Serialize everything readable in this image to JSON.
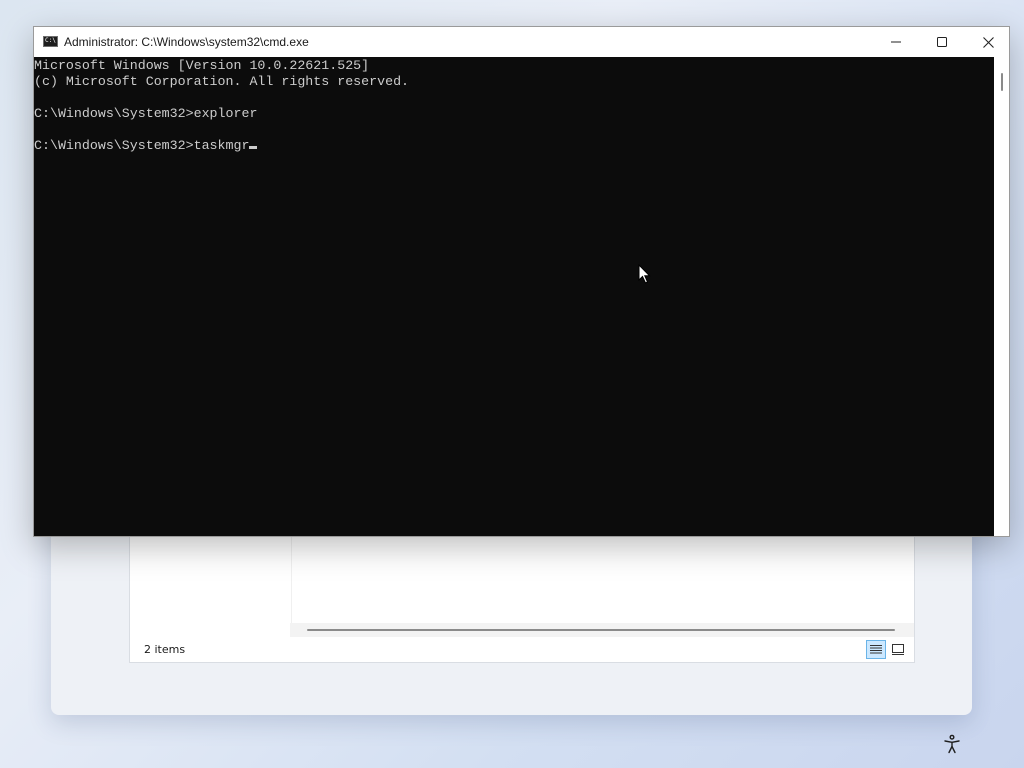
{
  "cmd": {
    "window_title": "Administrator: C:\\Windows\\system32\\cmd.exe",
    "icon": "cmd-icon",
    "icon_text": "C:\\",
    "lines": [
      "Microsoft Windows [Version 10.0.22621.525]",
      "(c) Microsoft Corporation. All rights reserved.",
      "",
      "C:\\Windows\\System32>explorer",
      "",
      "C:\\Windows\\System32>taskmgr"
    ],
    "background": "#0c0c0c",
    "foreground": "#cccccc"
  },
  "explorer": {
    "status_text": "2 items",
    "view_buttons": [
      "details-view-icon",
      "large-icons-view-icon"
    ]
  },
  "taskbar": {
    "accessibility_icon": "accessibility-icon"
  }
}
